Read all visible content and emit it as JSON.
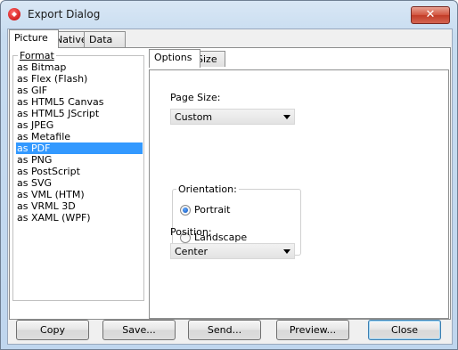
{
  "window": {
    "title": "Export Dialog",
    "close_glyph": "✕"
  },
  "main_tabs": [
    {
      "label": "Picture",
      "active": true
    },
    {
      "label": "Native",
      "active": false
    },
    {
      "label": "Data",
      "active": false
    }
  ],
  "format": {
    "legend": "Format",
    "items": [
      "as Bitmap",
      "as Flex (Flash)",
      "as GIF",
      "as HTML5 Canvas",
      "as HTML5 JScript",
      "as JPEG",
      "as Metafile",
      "as PDF",
      "as PNG",
      "as PostScript",
      "as SVG",
      "as VML (HTM)",
      "as VRML 3D",
      "as XAML (WPF)"
    ],
    "selected": "as PDF"
  },
  "options_tabs": [
    {
      "label": "Options",
      "active": true
    },
    {
      "label": "Size",
      "active": false
    }
  ],
  "options": {
    "page_size_label": "Page Size:",
    "page_size_value": "Custom",
    "orientation_label": "Orientation:",
    "portrait_label": "Portrait",
    "landscape_label": "Landscape",
    "orientation_selected": "Portrait",
    "position_label": "Position:",
    "position_value": "Center"
  },
  "buttons": {
    "copy": "Copy",
    "save": "Save...",
    "send": "Send...",
    "preview": "Preview...",
    "close": "Close"
  },
  "colors": {
    "selection": "#3399ff",
    "title_close": "#c23c27"
  }
}
